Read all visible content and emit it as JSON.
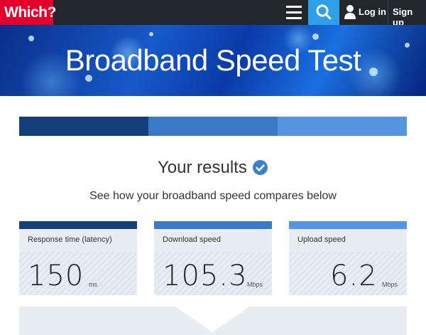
{
  "nav": {
    "logo": "Which?",
    "login_label": "Log in",
    "signup_label": "Sign up",
    "icons": [
      "menu-icon",
      "search-icon",
      "user-icon"
    ],
    "colors": {
      "logo_bg": "#e4002b",
      "search_bg": "#2f9fe8",
      "bar_bg": "#22272b"
    }
  },
  "hero": {
    "title": "Broadband Speed Test"
  },
  "progress": {
    "steps_completed": 3,
    "steps_total": 3,
    "colors": [
      "#153f7a",
      "#3a78c9",
      "#5594e0"
    ]
  },
  "results": {
    "title": "Your results",
    "subtitle": "See how your broadband speed compares below",
    "metrics": [
      {
        "label": "Response time (latency)",
        "value": "150",
        "unit": "ms",
        "accent": "#153f7a"
      },
      {
        "label": "Download speed",
        "value": "105.3",
        "unit": "Mbps",
        "accent": "#3a78c9"
      },
      {
        "label": "Upload speed",
        "value": "6.2",
        "unit": "Mbps",
        "accent": "#5594e0"
      }
    ]
  }
}
